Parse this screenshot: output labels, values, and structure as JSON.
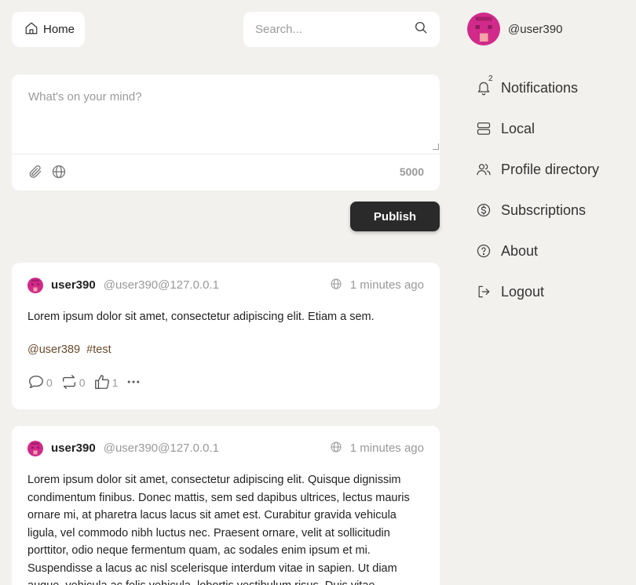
{
  "header": {
    "home_label": "Home",
    "search_placeholder": "Search..."
  },
  "composer": {
    "placeholder": "What's on your mind?",
    "char_count": "5000",
    "publish_label": "Publish"
  },
  "profile": {
    "handle": "@user390"
  },
  "nav": {
    "notifications": "Notifications",
    "notifications_count": "2",
    "local": "Local",
    "profile_directory": "Profile directory",
    "subscriptions": "Subscriptions",
    "about": "About",
    "logout": "Logout"
  },
  "posts": [
    {
      "author": "user390",
      "handle": "@user390@127.0.0.1",
      "time": "1 minutes ago",
      "body": "Lorem ipsum dolor sit amet, consectetur adipiscing elit. Etiam a sem.",
      "mention": "@user389",
      "hashtag": "#test",
      "replies": "0",
      "reposts": "0",
      "likes": "1"
    },
    {
      "author": "user390",
      "handle": "@user390@127.0.0.1",
      "time": "1 minutes ago",
      "body": "Lorem ipsum dolor sit amet, consectetur adipiscing elit. Quisque dignissim condimentum finibus. Donec mattis, sem sed dapibus ultrices, lectus mauris ornare mi, at pharetra lacus lacus sit amet est. Curabitur gravida vehicula ligula, vel commodo nibh luctus nec. Praesent ornare, velit at sollicitudin porttitor, odio neque fermentum quam, ac sodales enim ipsum et mi. Suspendisse a lacus ac nisl scelerisque interdum vitae in sapien. Ut diam augue, vehicula ac felis vehicula, lobortis vestibulum risus. Duis vitae"
    }
  ],
  "colors": {
    "background": "#f2f1ee",
    "avatar_primary": "#d12a8a",
    "avatar_accent": "#f4a3a8",
    "link": "#6b4a2b",
    "publish_bg": "#2a2a2a"
  }
}
